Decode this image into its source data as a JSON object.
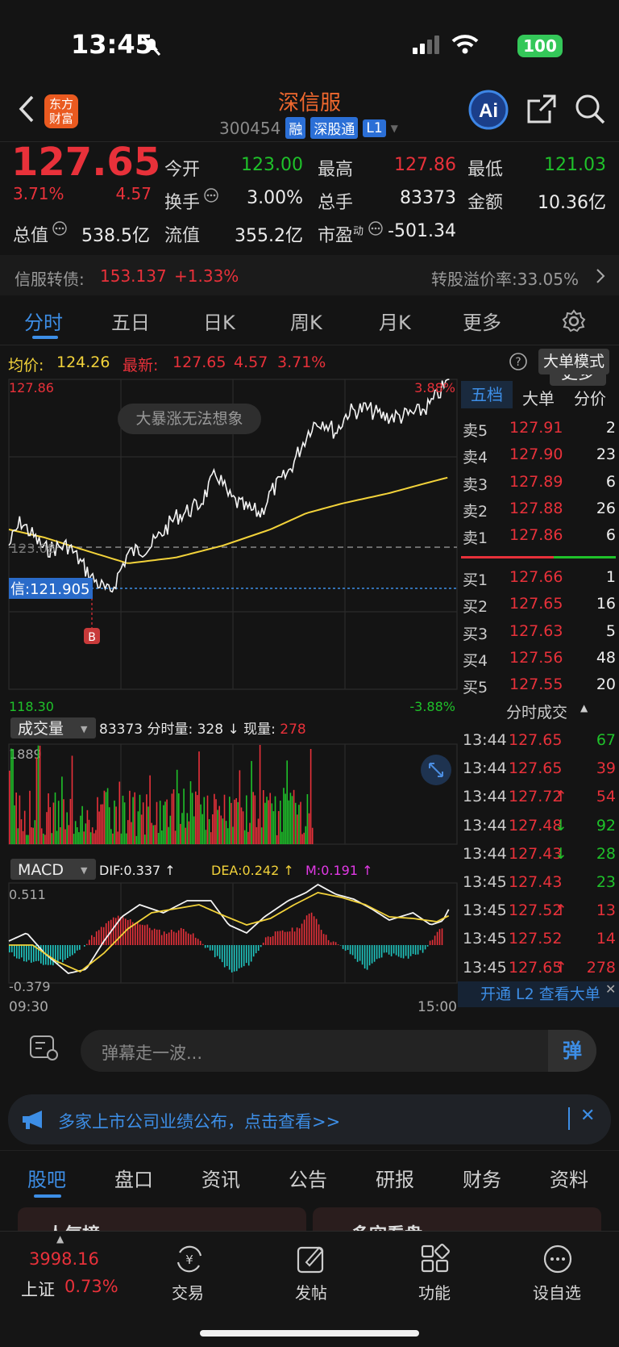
{
  "status": {
    "time": "13:45",
    "battery": "100"
  },
  "header": {
    "logo": "东方\n财富",
    "title": "深信服",
    "code": "300454",
    "tags": [
      "融",
      "深股通",
      "L1"
    ]
  },
  "quote": {
    "price": "127.65",
    "pct": "3.71%",
    "chg": "4.57",
    "jinkai_l": "今开",
    "jinkai": "123.00",
    "zuigao_l": "最高",
    "zuigao": "127.86",
    "zuidi_l": "最低",
    "zuidi": "121.03",
    "huanshou_l": "换手",
    "huanshou": "3.00%",
    "zongshou_l": "总手",
    "zongshou": "83373",
    "jine_l": "金额",
    "jine": "10.36亿",
    "zongzhi_l": "总值",
    "zongzhi": "538.5亿",
    "liuzhi_l": "流值",
    "liuzhi": "355.2亿",
    "shiying_l": "市盈",
    "shiying_sup": "动",
    "shiying": "-501.34",
    "more": "更多"
  },
  "bond": {
    "label": "信服转债:",
    "price": "153.137",
    "chg": "+1.33%",
    "premium": "转股溢价率:33.05%"
  },
  "tabs": [
    "分时",
    "五日",
    "日K",
    "周K",
    "月K",
    "更多"
  ],
  "info": {
    "avg_l": "均价:",
    "avg": "124.26",
    "last_l": "最新:",
    "last": "127.65",
    "chg": "4.57",
    "pct": "3.71%",
    "mode": "大单模式"
  },
  "chart_data": {
    "type": "line",
    "y_top": "127.86",
    "y_bot": "118.30",
    "pct_top": "3.88%",
    "pct_bot": "-3.88%",
    "ref": "123.08",
    "line_label": "信:121.905",
    "badge": "B",
    "bubble": "大暴涨无法想象",
    "x_start": "09:30",
    "x_end": "15:00",
    "vol_label": "成交量",
    "vol_info": "83373 分时量: 328 ↓ 现量:",
    "vol_now": "278",
    "vol_max": "1889",
    "macd_label": "MACD",
    "dif": "DIF:0.337 ↑",
    "dea": "DEA:0.242 ↑",
    "m": "M:0.191 ↑",
    "macd_top": "0.511",
    "macd_bot": "-0.379"
  },
  "orderbook": {
    "tabs": [
      "五档",
      "大单",
      "分价"
    ],
    "asks": [
      [
        "卖5",
        "127.91",
        "2"
      ],
      [
        "卖4",
        "127.90",
        "23"
      ],
      [
        "卖3",
        "127.89",
        "6"
      ],
      [
        "卖2",
        "127.88",
        "26"
      ],
      [
        "卖1",
        "127.86",
        "6"
      ]
    ],
    "bids": [
      [
        "买1",
        "127.66",
        "1"
      ],
      [
        "买2",
        "127.65",
        "16"
      ],
      [
        "买3",
        "127.63",
        "5"
      ],
      [
        "买4",
        "127.56",
        "48"
      ],
      [
        "买5",
        "127.55",
        "20"
      ]
    ]
  },
  "trades": {
    "title": "分时成交",
    "rows": [
      [
        "13:44",
        "127.65",
        "",
        "67",
        "g"
      ],
      [
        "13:44",
        "127.65",
        "",
        "39",
        "r"
      ],
      [
        "13:44",
        "127.72",
        "↑",
        "54",
        "r"
      ],
      [
        "13:44",
        "127.48",
        "↓",
        "92",
        "g"
      ],
      [
        "13:44",
        "127.43",
        "↓",
        "28",
        "g"
      ],
      [
        "13:45",
        "127.43",
        "",
        "23",
        "g"
      ],
      [
        "13:45",
        "127.52",
        "↑",
        "13",
        "r"
      ],
      [
        "13:45",
        "127.52",
        "",
        "14",
        "r"
      ],
      [
        "13:45",
        "127.65",
        "↑",
        "278",
        "r"
      ]
    ],
    "l2": "开通 L2 查看大单"
  },
  "danmu": {
    "placeholder": "弹幕走一波...",
    "btn": "弹"
  },
  "notice": {
    "text": "多家上市公司业绩公布，点击查看>>"
  },
  "bottom_tabs": [
    "股吧",
    "盘口",
    "资讯",
    "公告",
    "研报",
    "财务",
    "资料"
  ],
  "peek": [
    "人气榜",
    "多空看盘"
  ],
  "tabbar": {
    "index_val": "3998.16",
    "index_name": "上证",
    "index_pct": "0.73%",
    "items": [
      "交易",
      "发帖",
      "功能",
      "设自选"
    ]
  }
}
